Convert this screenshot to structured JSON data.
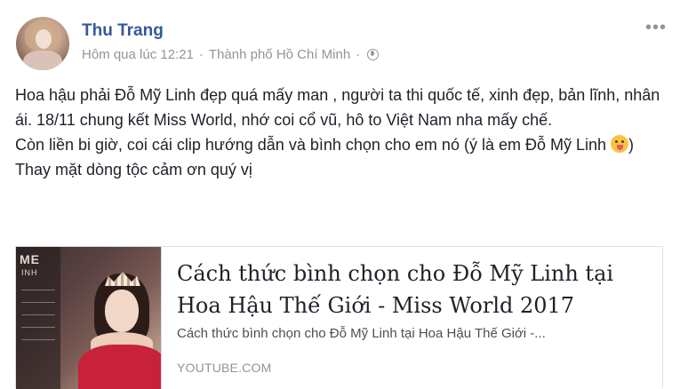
{
  "author": {
    "name": "Thu Trang",
    "timestamp": "Hôm qua lúc 12:21",
    "separator": "·",
    "location": "Thành phố Hồ Chí Minh",
    "privacy_icon": "globe-icon"
  },
  "post": {
    "line1": "Hoa hậu phải Đỗ Mỹ Linh đẹp quá mấy man , người ta thi quốc tế, xinh đẹp, bản lĩnh, nhân ái. 18/11 chung kết Miss World, nhớ coi cổ vũ, hô to Việt Nam nha mấy chế.",
    "line2_before_emoji": "Còn liền bi giờ, coi cái clip hướng dẫn và bình chọn cho em nó (ý là em Đỗ Mỹ Linh ",
    "line2_after_emoji": ")",
    "emoji": "tongue-out-emoji",
    "line3": "Thay mặt dòng tộc cảm ơn quý vị"
  },
  "link_card": {
    "thumbnail_text_1": "ME",
    "thumbnail_text_2": "INH",
    "title": "Cách thức bình chọn cho Đỗ Mỹ Linh tại Hoa Hậu Thế Giới - Miss World 2017",
    "description": "Cách thức bình chọn cho Đỗ Mỹ Linh tại Hoa Hậu Thế Giới -...",
    "domain": "YOUTUBE.COM"
  },
  "menu": {
    "more_label": "•••"
  }
}
